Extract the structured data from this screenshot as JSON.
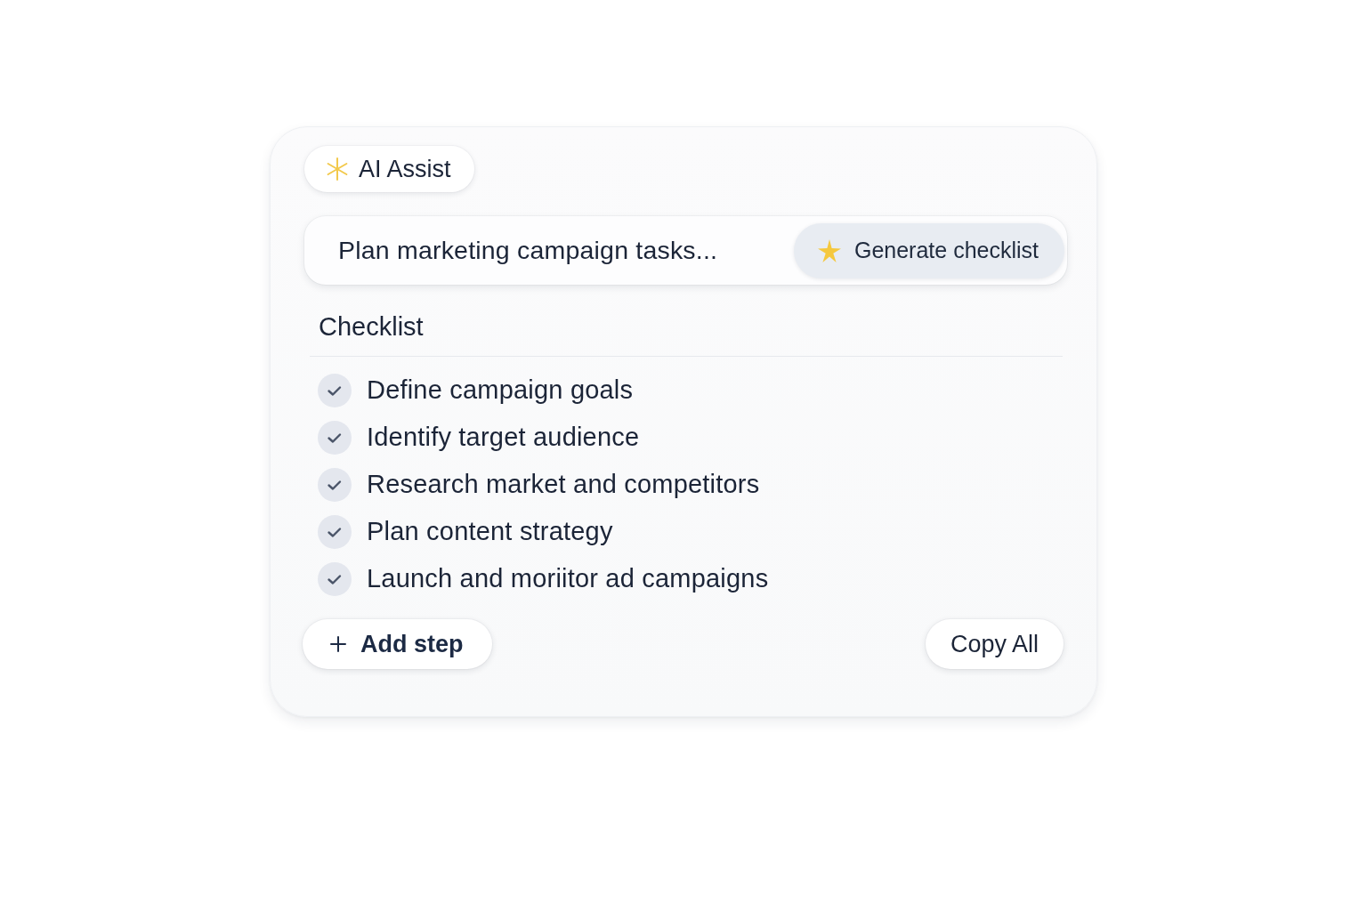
{
  "badge": {
    "label": "AI Assist"
  },
  "prompt": {
    "value": "Plan marketing campaign tasks...",
    "button": "Generate checklist"
  },
  "checklist": {
    "title": "Checklist",
    "items": [
      {
        "label": "Define campaign goals",
        "checked": true
      },
      {
        "label": "Identify target audience",
        "checked": true
      },
      {
        "label": "Research market and competitors",
        "checked": true
      },
      {
        "label": "Plan content strategy",
        "checked": true
      },
      {
        "label": "Launch and moriitor ad campaigns",
        "checked": true
      }
    ]
  },
  "actions": {
    "add": "Add step",
    "copy": "Copy All"
  }
}
